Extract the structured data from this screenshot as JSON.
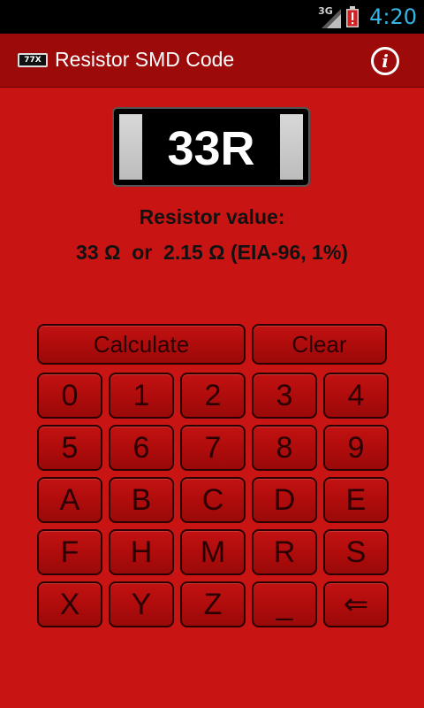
{
  "status_bar": {
    "network_label": "3G",
    "time": "4:20",
    "time_color": "#33b5e5"
  },
  "app_bar": {
    "icon_text": "77X",
    "title": "Resistor SMD Code",
    "info_glyph": "i",
    "background": "#9c0a0a"
  },
  "chip": {
    "code": "33R"
  },
  "result": {
    "label": "Resistor value:",
    "value1": "33 Ω",
    "connector": "or",
    "value2": "2.15 Ω (EIA-96, 1%)"
  },
  "actions": {
    "calculate": "Calculate",
    "clear": "Clear"
  },
  "keys": [
    [
      "0",
      "1",
      "2",
      "3",
      "4"
    ],
    [
      "5",
      "6",
      "7",
      "8",
      "9"
    ],
    [
      "A",
      "B",
      "C",
      "D",
      "E"
    ],
    [
      "F",
      "H",
      "M",
      "R",
      "S"
    ],
    [
      "X",
      "Y",
      "Z",
      "_",
      "⇐"
    ]
  ],
  "colors": {
    "background": "#c91414",
    "button_border": "#2a0000"
  }
}
